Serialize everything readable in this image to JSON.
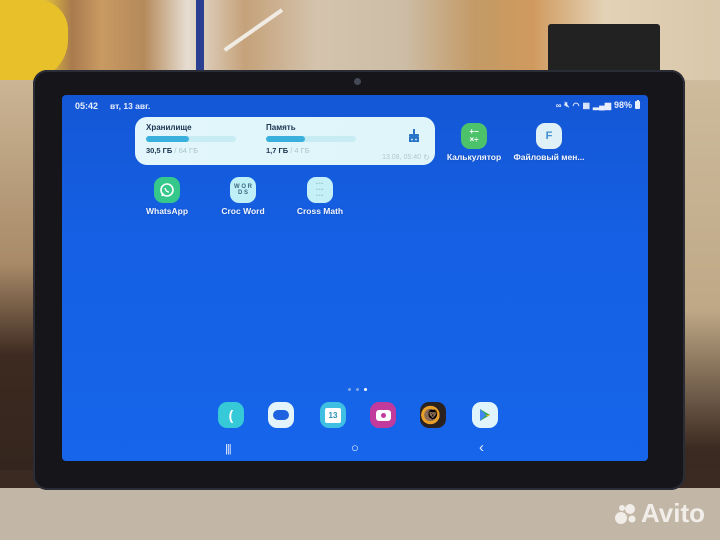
{
  "status_bar": {
    "time": "05:42",
    "date": "вт, 13 авг.",
    "icons": [
      "link-icon",
      "mute-icon",
      "wifi-icon",
      "nfc-icon",
      "signal-icon"
    ],
    "battery": "98%"
  },
  "storage_widget": {
    "storage": {
      "label": "Хранилище",
      "used": "30,5 ГБ",
      "total": "/ 64 ГБ",
      "fraction": 0.48
    },
    "memory": {
      "label": "Память",
      "used": "1,7 ГБ",
      "total": "/ 4 ГБ",
      "fraction": 0.43
    },
    "updated": "13.08, 05:40",
    "refresh_icon": "refresh-icon",
    "clean_icon": "broom-icon"
  },
  "home_apps": [
    {
      "label": "Калькулятор",
      "icon": "calculator-icon",
      "color": "#4cc36a"
    },
    {
      "label": "Файловый мен...",
      "icon": "file-manager-icon",
      "color": "#dff1f7"
    },
    {
      "label": "WhatsApp",
      "icon": "whatsapp-icon",
      "color": "#35c88a"
    },
    {
      "label": "Croc Word",
      "icon": "croc-word-icon",
      "color": "#bfeff7"
    },
    {
      "label": "Cross Math",
      "icon": "cross-math-icon",
      "color": "#c6f0f8"
    }
  ],
  "page_indicator": {
    "pages": 3,
    "active": 3
  },
  "dock": [
    {
      "name": "phone",
      "icon": "phone-icon",
      "color": "#36c9d8"
    },
    {
      "name": "messages",
      "icon": "messages-icon",
      "color": "#e4f4fb"
    },
    {
      "name": "calendar",
      "icon": "calendar-icon",
      "color": "#3fc0e2",
      "text": "13"
    },
    {
      "name": "camera",
      "icon": "camera-icon",
      "color": "#c23a9b"
    },
    {
      "name": "game",
      "icon": "game-icon",
      "color": "#2a2220"
    },
    {
      "name": "play-store",
      "icon": "play-store-icon",
      "color": "#dff4fb"
    }
  ],
  "nav_bar": {
    "recents": "|||",
    "home": "○",
    "back": "‹"
  },
  "watermark": "Avito"
}
